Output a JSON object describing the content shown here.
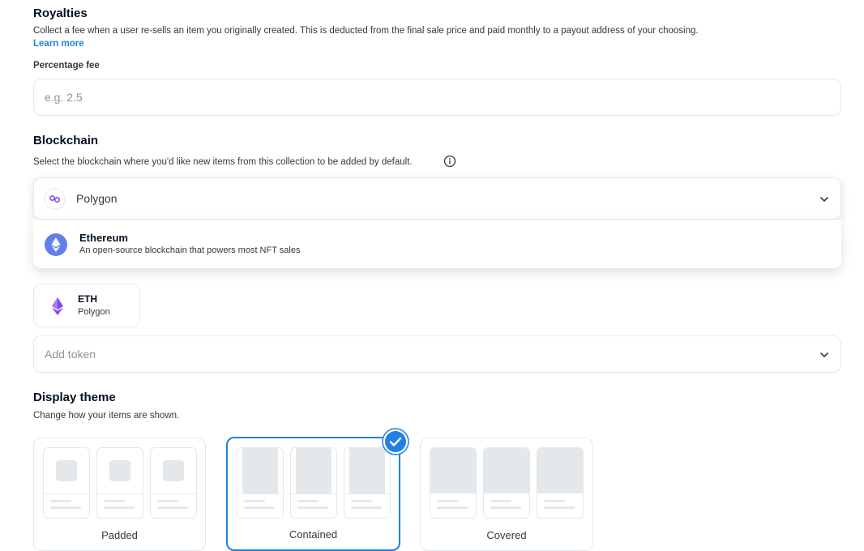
{
  "royalties": {
    "title": "Royalties",
    "description": "Collect a fee when a user re-sells an item you originally created. This is deducted from the final sale price and paid monthly to a payout address of your choosing.",
    "learn_more": "Learn more",
    "fee_label": "Percentage fee",
    "fee_placeholder": "e.g. 2.5"
  },
  "blockchain": {
    "title": "Blockchain",
    "description": "Select the blockchain where you'd like new items from this collection to be added by default.",
    "info_icon": "info-icon",
    "selected": "Polygon",
    "selected_icon": "polygon-icon",
    "options": [
      {
        "name": "Ethereum",
        "description": "An open-source blockchain that powers most NFT sales",
        "icon": "ethereum-icon"
      }
    ]
  },
  "tokens": {
    "items": [
      {
        "symbol": "ETH",
        "network": "Polygon",
        "icon": "eth-icon"
      }
    ],
    "add_placeholder": "Add token"
  },
  "display_theme": {
    "title": "Display theme",
    "description": "Change how your items are shown.",
    "options": [
      {
        "name": "Padded",
        "selected": false
      },
      {
        "name": "Contained",
        "selected": true
      },
      {
        "name": "Covered",
        "selected": false
      }
    ]
  },
  "colors": {
    "accent": "#2081e2",
    "heading": "#04111d",
    "border": "#e5e8eb",
    "placeholder": "#8a939b"
  }
}
